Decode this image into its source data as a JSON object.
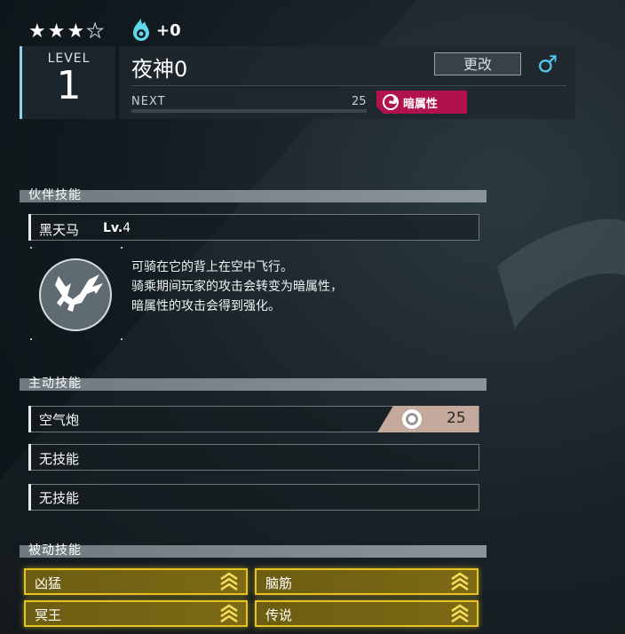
{
  "header": {
    "rarity": {
      "filled": 3,
      "total": 4
    },
    "condenser": "+0",
    "level_label": "LEVEL",
    "level": "1",
    "name": "夜神0",
    "rename_label": "更改",
    "gender_icon": "♂",
    "next_label": "NEXT",
    "next_value": "25",
    "exp_progress": 0,
    "element": {
      "label": "暗属性",
      "color": "#b0134b",
      "icon": "dark-element-icon"
    }
  },
  "partner_skill": {
    "section_title": "伙伴技能",
    "name": "黑天马",
    "level_prefix": "Lv.",
    "level": "4",
    "description_lines": [
      "可骑在它的背上在空中飞行。",
      "骑乘期间玩家的攻击会转变为暗属性，",
      "暗属性的攻击会得到强化。"
    ]
  },
  "active_skills": {
    "section_title": "主动技能",
    "items": [
      {
        "name": "空气炮",
        "power": "25"
      },
      {
        "name": "无技能"
      },
      {
        "name": "无技能"
      }
    ]
  },
  "passive_skills": {
    "section_title": "被动技能",
    "items": [
      {
        "name": "凶猛",
        "icon": "rank-up-chevrons-icon"
      },
      {
        "name": "脑筋",
        "icon": "rank-up-chevrons-icon"
      },
      {
        "name": "冥王",
        "icon": "rank-up-chevrons-icon"
      },
      {
        "name": "传说",
        "icon": "rank-up-chevrons-icon"
      }
    ]
  }
}
